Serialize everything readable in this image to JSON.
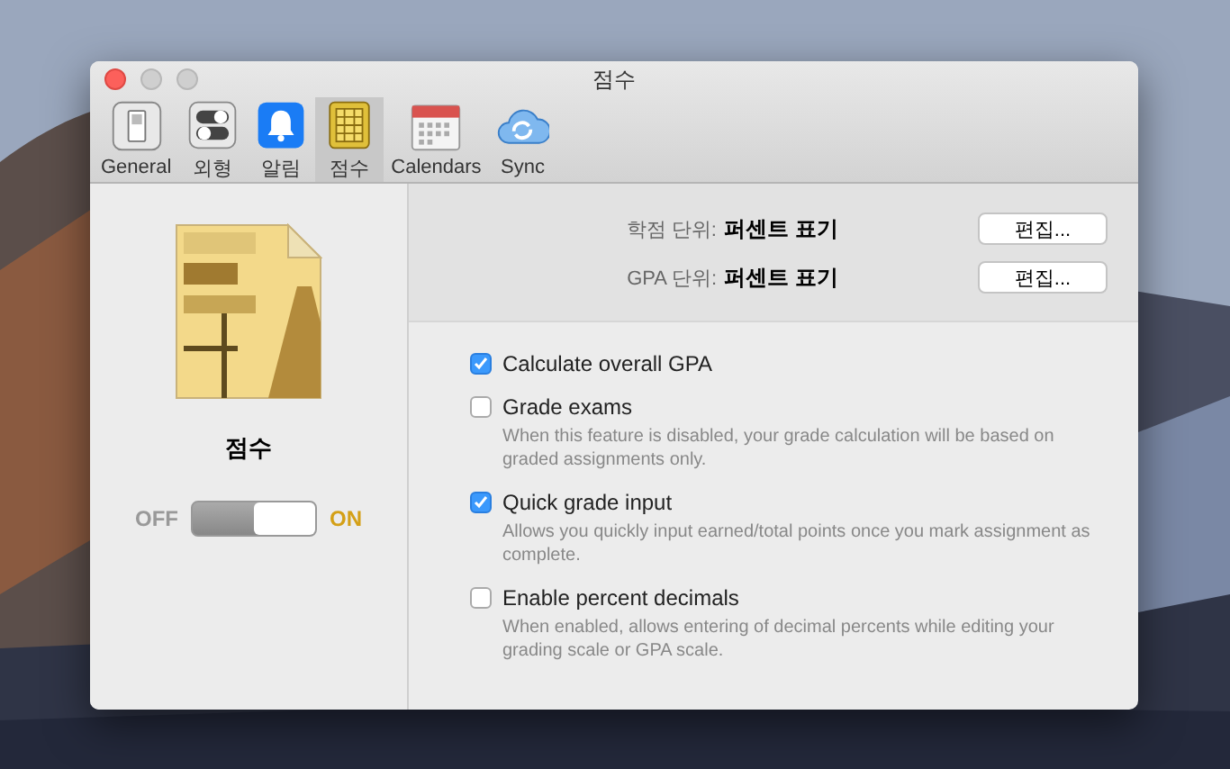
{
  "window": {
    "title": "점수"
  },
  "toolbar": [
    {
      "label": "General",
      "selected": false
    },
    {
      "label": "외형",
      "selected": false
    },
    {
      "label": "알림",
      "selected": false
    },
    {
      "label": "점수",
      "selected": true
    },
    {
      "label": "Calendars",
      "selected": false
    },
    {
      "label": "Sync",
      "selected": false
    }
  ],
  "module": {
    "name": "점수",
    "switch": {
      "off_label": "OFF",
      "on_label": "ON",
      "on": true
    }
  },
  "units": [
    {
      "label": "학점 단위:",
      "value": "퍼센트 표기",
      "button": "편집..."
    },
    {
      "label": "GPA 단위:",
      "value": "퍼센트 표기",
      "button": "편집..."
    }
  ],
  "options": [
    {
      "label": "Calculate overall GPA",
      "checked": true
    },
    {
      "label": "Grade exams",
      "checked": false,
      "description": "When this feature is disabled, your grade calculation will be based on graded assignments only."
    },
    {
      "label": "Quick grade input",
      "checked": true,
      "description": "Allows you quickly input earned/total points once you mark assignment as complete."
    },
    {
      "label": "Enable percent decimals",
      "checked": false,
      "description": "When enabled, allows entering of decimal percents while editing your grading scale or GPA scale."
    }
  ]
}
